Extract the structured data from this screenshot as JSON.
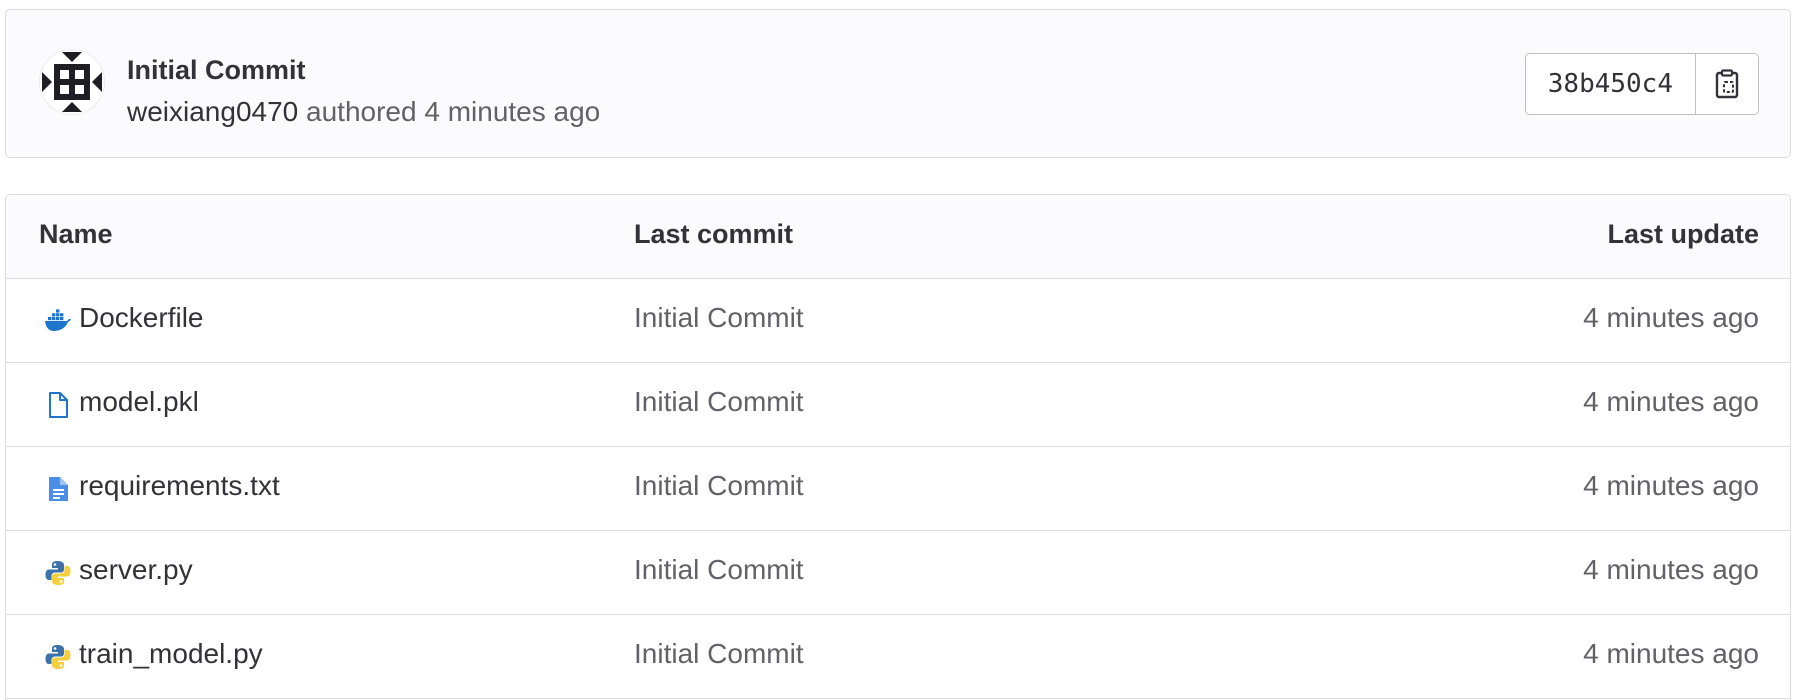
{
  "commit": {
    "title": "Initial Commit",
    "author": "weixiang0470",
    "authored_word": "authored",
    "time": "4 minutes ago",
    "sha": "38b450c4"
  },
  "table": {
    "headers": {
      "name": "Name",
      "last_commit": "Last commit",
      "last_update": "Last update"
    },
    "rows": [
      {
        "name": "Dockerfile",
        "icon": "docker-icon",
        "last_commit": "Initial Commit",
        "last_update": "4 minutes ago"
      },
      {
        "name": "model.pkl",
        "icon": "file-icon",
        "last_commit": "Initial Commit",
        "last_update": "4 minutes ago"
      },
      {
        "name": "requirements.txt",
        "icon": "text-file-icon",
        "last_commit": "Initial Commit",
        "last_update": "4 minutes ago"
      },
      {
        "name": "server.py",
        "icon": "python-icon",
        "last_commit": "Initial Commit",
        "last_update": "4 minutes ago"
      },
      {
        "name": "train_model.py",
        "icon": "python-icon",
        "last_commit": "Initial Commit",
        "last_update": "4 minutes ago"
      }
    ]
  },
  "colors": {
    "link_blue": "#1f75cb",
    "text_primary": "#333238",
    "text_secondary": "#626168",
    "border": "#dcdcde"
  }
}
